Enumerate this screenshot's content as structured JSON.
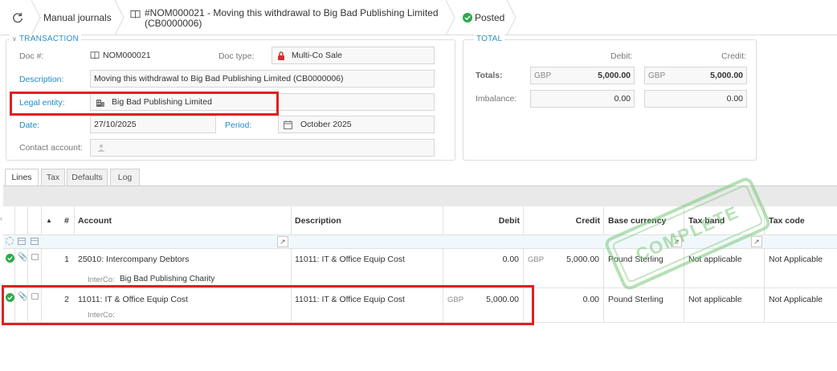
{
  "breadcrumb": {
    "journals_label": "Manual journals",
    "doc_title": "#NOM000021 - Moving this withdrawal to Big Bad Publishing Limited",
    "doc_subtitle": "(CB0000006)",
    "status": "Posted"
  },
  "transaction": {
    "legend": "TRANSACTION",
    "doc_no_label": "Doc #:",
    "doc_no": "NOM000021",
    "doc_type_label": "Doc type:",
    "doc_type": "Multi-Co Sale",
    "description_label": "Description:",
    "description": "Moving this withdrawal to Big Bad Publishing Limited (CB0000006)",
    "legal_entity_label": "Legal entity:",
    "legal_entity": "Big Bad Publishing Limited",
    "date_label": "Date:",
    "date": "27/10/2025",
    "period_label": "Period:",
    "period": "October 2025",
    "contact_label": "Contact account:",
    "contact": ""
  },
  "total": {
    "legend": "TOTAL",
    "debit_label": "Debit:",
    "credit_label": "Credit:",
    "totals_label": "Totals:",
    "imbalance_label": "Imbalance:",
    "currency": "GBP",
    "debit_total": "5,000.00",
    "credit_total": "5,000.00",
    "debit_imbalance": "0.00",
    "credit_imbalance": "0.00"
  },
  "tabs": [
    "Lines",
    "Tax",
    "Defaults",
    "Log"
  ],
  "grid": {
    "headers": {
      "num": "#",
      "account": "Account",
      "description": "Description",
      "debit": "Debit",
      "credit": "Credit",
      "base_currency": "Base currency",
      "tax_band": "Tax band",
      "tax_code": "Tax code"
    },
    "intercompany_label": "InterCo:",
    "rows": [
      {
        "num": "1",
        "account": "25010: Intercompany Debtors",
        "description": "11011: IT & Office Equip Cost",
        "debit_currency": "",
        "debit": "0.00",
        "credit_currency": "GBP",
        "credit": "5,000.00",
        "base_currency": "Pound Sterling",
        "tax_band": "Not applicable",
        "tax_code": "Not Applicable",
        "interco": "Big Bad Publishing Charity"
      },
      {
        "num": "2",
        "account": "11011: IT & Office Equip Cost",
        "description": "11011: IT & Office Equip Cost",
        "debit_currency": "GBP",
        "debit": "5,000.00",
        "credit_currency": "",
        "credit": "0.00",
        "base_currency": "Pound Sterling",
        "tax_band": "Not applicable",
        "tax_code": "Not Applicable",
        "interco": ""
      }
    ]
  },
  "stamp": "COMPLETE",
  "colors": {
    "link": "#1f8bc4",
    "status_green": "#2ea84a",
    "highlight_red": "#e02020",
    "stamp_green": "#78c878"
  }
}
